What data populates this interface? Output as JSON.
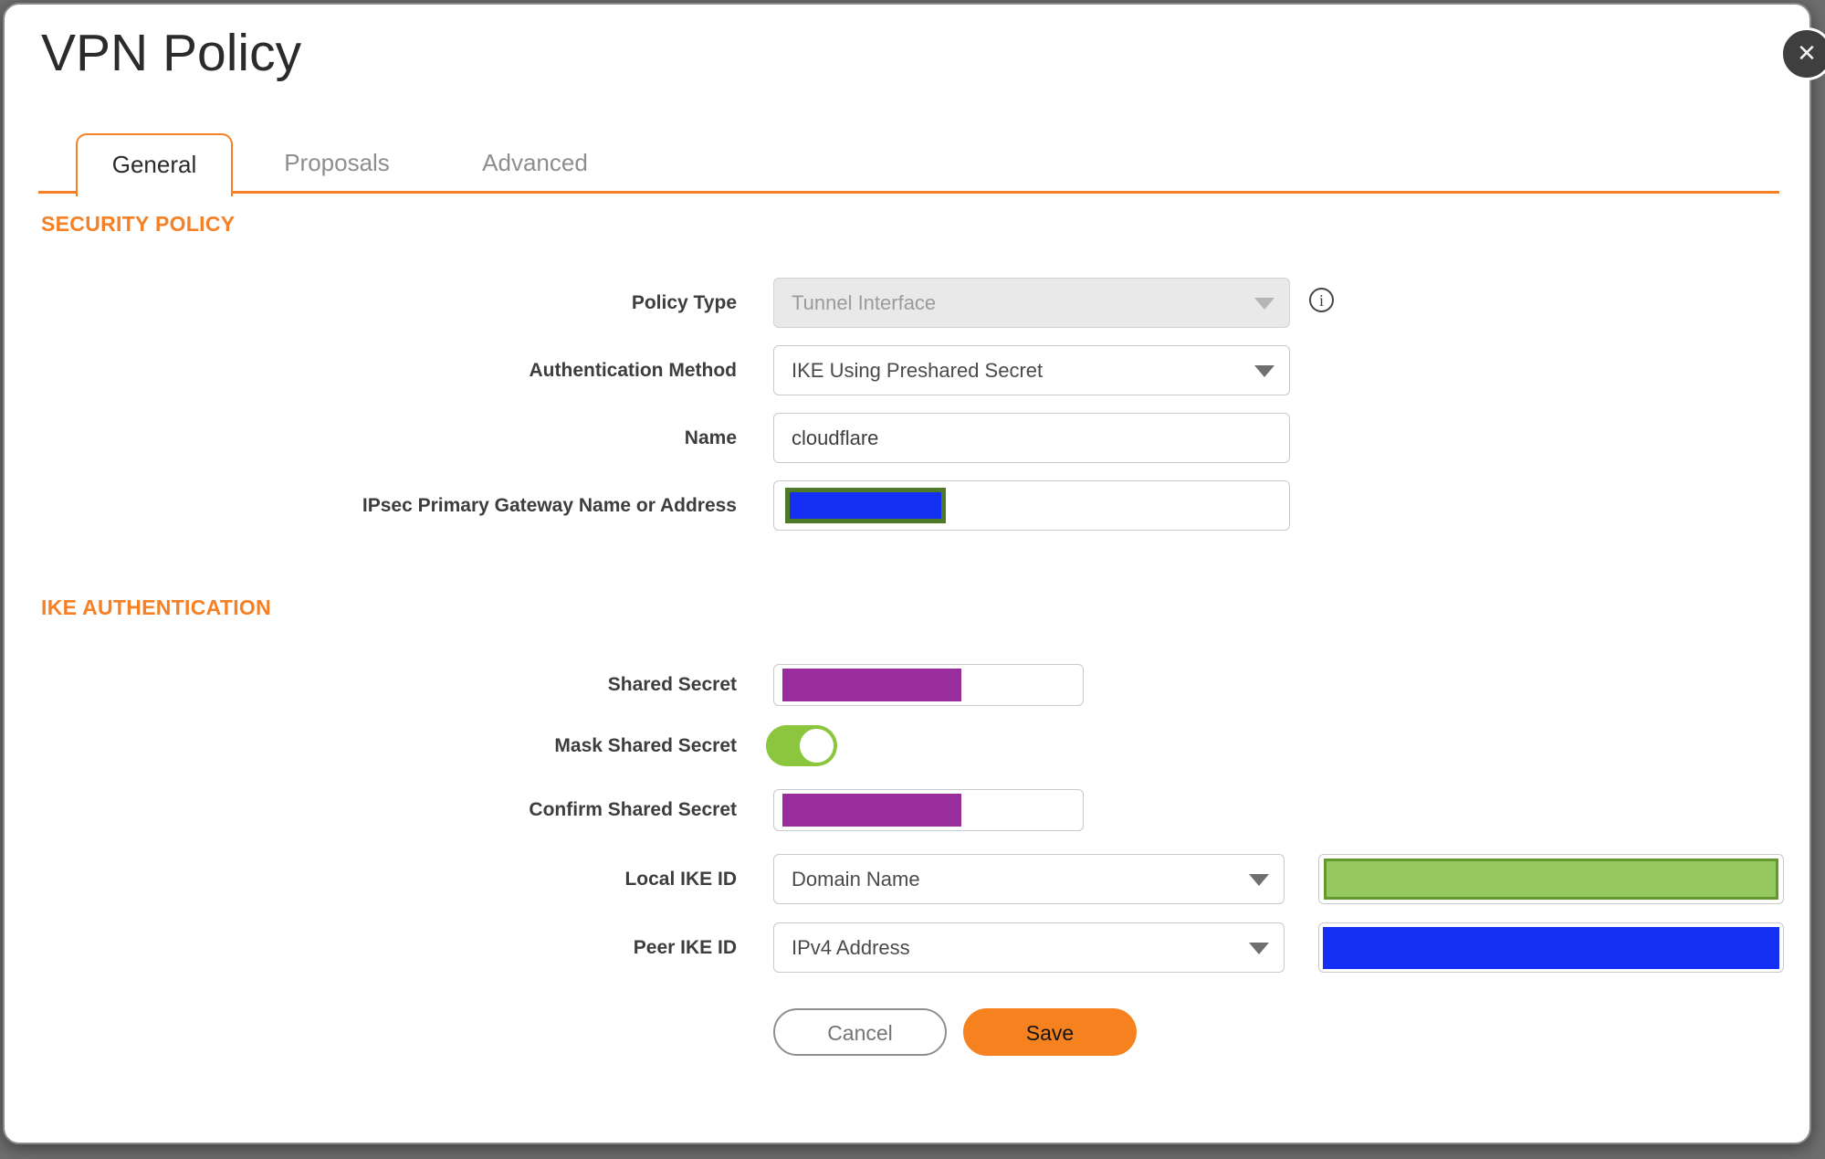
{
  "window": {
    "title": "VPN Policy",
    "close_icon": "✕"
  },
  "tabs": {
    "general": "General",
    "proposals": "Proposals",
    "advanced": "Advanced",
    "active_tab": "General"
  },
  "security_policy": {
    "heading": "SECURITY POLICY",
    "policy_type_label": "Policy Type",
    "policy_type_value": "Tunnel Interface",
    "policy_type_disabled": true,
    "info_icon": "i",
    "auth_method_label": "Authentication Method",
    "auth_method_value": "IKE Using Preshared Secret",
    "name_label": "Name",
    "name_value": "cloudflare",
    "gateway_label": "IPsec Primary Gateway Name or Address",
    "gateway_value": "[redacted]"
  },
  "ike_authentication": {
    "heading": "IKE AUTHENTICATION",
    "shared_secret_label": "Shared Secret",
    "shared_secret_value": "[redacted]",
    "mask_shared_secret_label": "Mask Shared Secret",
    "mask_shared_secret_on": true,
    "confirm_shared_secret_label": "Confirm Shared Secret",
    "confirm_shared_secret_value": "[redacted]",
    "local_ike_id_label": "Local IKE ID",
    "local_ike_id_type": "Domain Name",
    "local_ike_id_value": "[redacted]",
    "peer_ike_id_label": "Peer IKE ID",
    "peer_ike_id_type": "IPv4 Address",
    "peer_ike_id_value": "[redacted]"
  },
  "actions": {
    "cancel": "Cancel",
    "save": "Save"
  },
  "colors": {
    "accent_orange": "#F58025",
    "save_orange": "#F6821F",
    "toggle_green": "#8CC63F",
    "redaction_purple": "#9A2D9E",
    "redaction_blue": "#1430F5",
    "redaction_green": "#95C95F",
    "redaction_green_border": "#64992F",
    "background_gray": "#6e6e6e"
  }
}
